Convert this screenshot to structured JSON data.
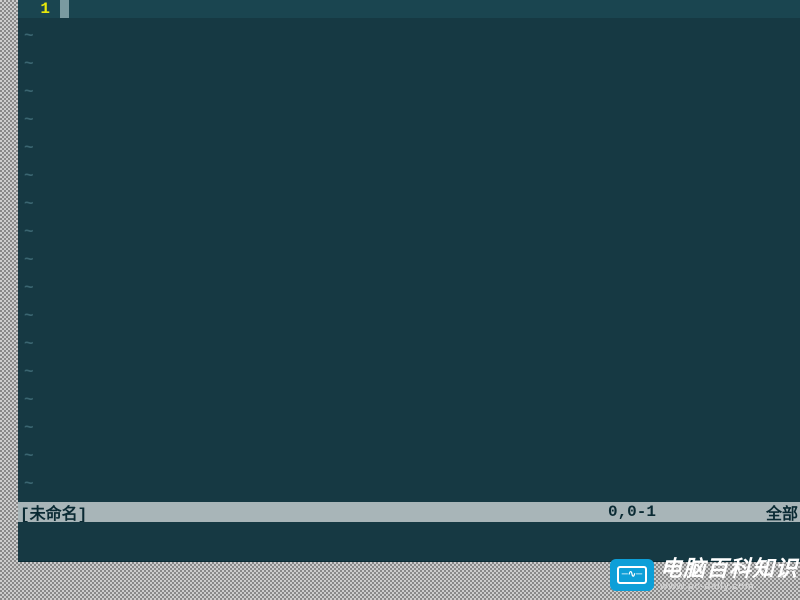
{
  "editor": {
    "line_number": "1",
    "tilde": "~",
    "tilde_count": 17
  },
  "status": {
    "filename": "[未命名]",
    "position": "0,0-1",
    "scroll": "全部"
  },
  "watermark": {
    "title": "电脑百科知识",
    "url": "www.pc-daily.com",
    "pulse": "─∿─"
  }
}
